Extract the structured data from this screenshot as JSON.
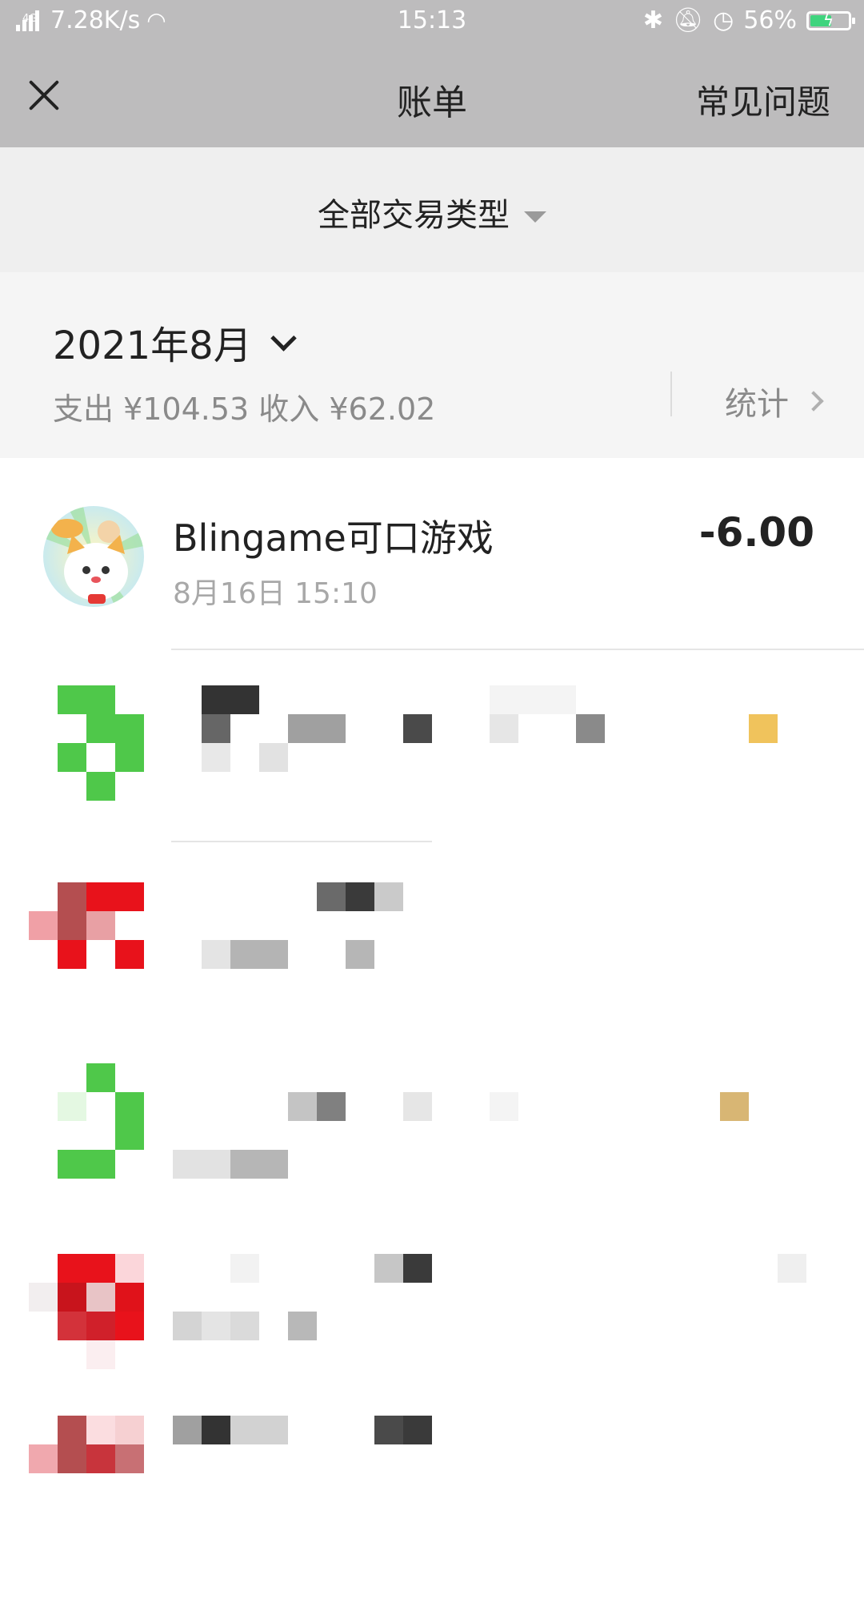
{
  "status_bar": {
    "network": "4G",
    "speed": "7.28K/s",
    "time": "15:13",
    "battery": "56%",
    "battery_level": 0.56
  },
  "navbar": {
    "title": "账单",
    "faq_label": "常见问题"
  },
  "filter": {
    "label": "全部交易类型"
  },
  "month_header": {
    "month": "2021年8月",
    "summary": "支出 ¥104.53 收入 ¥62.02",
    "stats_label": "统计"
  },
  "transactions": [
    {
      "title": "Blingame可口游戏",
      "time": "8月16日 15:10",
      "amount": "-6.00"
    }
  ],
  "colors": {
    "topbar": "#bdbcbd",
    "filter_bg": "#efefef",
    "month_bg": "#f5f5f5",
    "wechat_green": "#4fc84a",
    "red": "#e8121b"
  }
}
